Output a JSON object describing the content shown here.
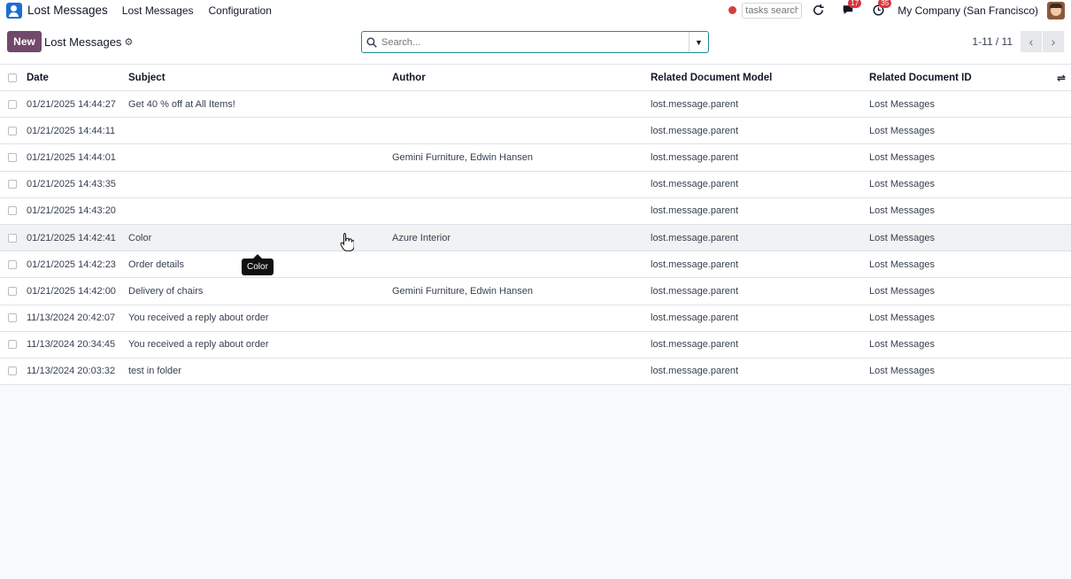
{
  "navbar": {
    "app_name": "Lost Messages",
    "menus": [
      "Lost Messages",
      "Configuration"
    ],
    "tasks_search_placeholder": "tasks search",
    "chat_badge": "17",
    "activity_badge": "35",
    "company": "My Company (San Francisco)"
  },
  "control": {
    "new_label": "New",
    "breadcrumb": "Lost Messages",
    "search_placeholder": "Search...",
    "pager": "1-11 / 11"
  },
  "table": {
    "columns": [
      "Date",
      "Subject",
      "Author",
      "Related Document Model",
      "Related Document ID"
    ],
    "rows": [
      {
        "date": "01/21/2025 14:44:27",
        "subject": "Get 40 % off at All Items!",
        "author": "",
        "model": "lost.message.parent",
        "doc_id": "Lost Messages"
      },
      {
        "date": "01/21/2025 14:44:11",
        "subject": "",
        "author": "",
        "model": "lost.message.parent",
        "doc_id": "Lost Messages"
      },
      {
        "date": "01/21/2025 14:44:01",
        "subject": "",
        "author": "Gemini Furniture, Edwin Hansen",
        "model": "lost.message.parent",
        "doc_id": "Lost Messages"
      },
      {
        "date": "01/21/2025 14:43:35",
        "subject": "",
        "author": "",
        "model": "lost.message.parent",
        "doc_id": "Lost Messages"
      },
      {
        "date": "01/21/2025 14:43:20",
        "subject": "",
        "author": "",
        "model": "lost.message.parent",
        "doc_id": "Lost Messages"
      },
      {
        "date": "01/21/2025 14:42:41",
        "subject": "Color",
        "author": "Azure Interior",
        "model": "lost.message.parent",
        "doc_id": "Lost Messages"
      },
      {
        "date": "01/21/2025 14:42:23",
        "subject": "Order details",
        "author": "",
        "model": "lost.message.parent",
        "doc_id": "Lost Messages"
      },
      {
        "date": "01/21/2025 14:42:00",
        "subject": "Delivery of chairs",
        "author": "Gemini Furniture, Edwin Hansen",
        "model": "lost.message.parent",
        "doc_id": "Lost Messages"
      },
      {
        "date": "11/13/2024 20:42:07",
        "subject": "You received a reply about order",
        "author": "",
        "model": "lost.message.parent",
        "doc_id": "Lost Messages"
      },
      {
        "date": "11/13/2024 20:34:45",
        "subject": "You received a reply about order",
        "author": "",
        "model": "lost.message.parent",
        "doc_id": "Lost Messages"
      },
      {
        "date": "11/13/2024 20:03:32",
        "subject": "test in folder",
        "author": "",
        "model": "lost.message.parent",
        "doc_id": "Lost Messages"
      }
    ],
    "hover_row_index": 5
  },
  "tooltip": "Color",
  "colors": {
    "primary": "#71496a",
    "search_border": "#1f8a94",
    "badge": "#d9363e",
    "app_icon": "#1b6fd1"
  }
}
